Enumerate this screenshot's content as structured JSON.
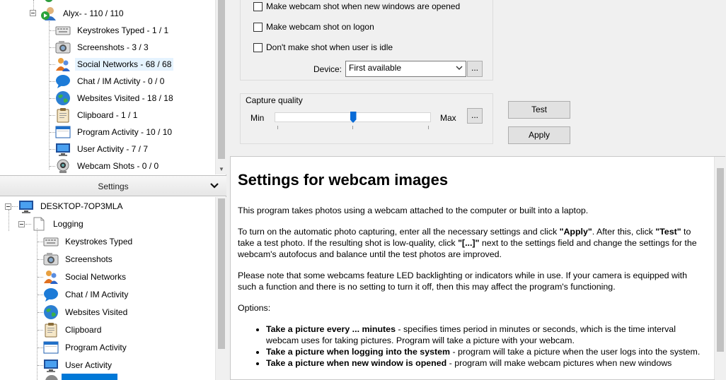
{
  "top_tree": {
    "user_node": "Alyx- - 110 / 110",
    "items": [
      {
        "label": "Keystrokes Typed - 1 / 1",
        "icon": "keyboard-icon"
      },
      {
        "label": "Screenshots - 3 / 3",
        "icon": "camera-icon"
      },
      {
        "label": "Social Networks - 68 / 68",
        "icon": "social-icon",
        "selected": true
      },
      {
        "label": "Chat / IM Activity - 0 / 0",
        "icon": "chat-icon"
      },
      {
        "label": "Websites Visited - 18 / 18",
        "icon": "globe-icon"
      },
      {
        "label": "Clipboard - 1 / 1",
        "icon": "clipboard-icon"
      },
      {
        "label": "Program Activity - 10 / 10",
        "icon": "window-icon"
      },
      {
        "label": "User Activity - 7 / 7",
        "icon": "monitor-icon"
      },
      {
        "label": "Webcam Shots - 0 / 0",
        "icon": "webcam-icon"
      }
    ]
  },
  "settings_bar": {
    "label": "Settings"
  },
  "bottom_tree": {
    "computer": "DESKTOP-7OP3MLA",
    "logging": "Logging",
    "items": [
      {
        "label": "Keystrokes Typed",
        "icon": "keyboard-icon"
      },
      {
        "label": "Screenshots",
        "icon": "camera-icon"
      },
      {
        "label": "Social Networks",
        "icon": "social-icon"
      },
      {
        "label": "Chat / IM Activity",
        "icon": "chat-icon"
      },
      {
        "label": "Websites Visited",
        "icon": "globe-icon"
      },
      {
        "label": "Clipboard",
        "icon": "clipboard-icon"
      },
      {
        "label": "Program Activity",
        "icon": "window-icon"
      },
      {
        "label": "User Activity",
        "icon": "monitor-icon"
      }
    ]
  },
  "webcam_settings": {
    "options": [
      {
        "label": "Make webcam shot when new windows are opened",
        "checked": false
      },
      {
        "label": "Make webcam shot on logon",
        "checked": false
      },
      {
        "label": "Don't make shot when user is idle",
        "checked": false
      }
    ],
    "device_label": "Device:",
    "device_value": "First available",
    "more_button": "...",
    "capture_quality_label": "Capture quality",
    "min_label": "Min",
    "max_label": "Max",
    "quality_value": 0.5,
    "test_button": "Test",
    "apply_button": "Apply"
  },
  "help": {
    "title": "Settings for webcam images",
    "p1": "This program takes photos using a webcam attached to the computer or built into a laptop.",
    "p2a": "To turn on the automatic photo capturing, enter all the necessary settings and click ",
    "p2b": "\"Apply\"",
    "p2c": ". After this, click ",
    "p2d": "\"Test\"",
    "p2e": " to take a test photo. If the resulting shot is low-quality, click ",
    "p2f": "\"[...]\"",
    "p2g": " next to the settings field and change the settings for the webcam's autofocus and balance until the test photos are improved.",
    "p3": "Please note that some webcams feature LED backlighting or indicators while in use. If your camera is equipped with such a function and there is no setting to turn it off, then this may affect the program's functioning.",
    "options_label": "Options:",
    "bullets": [
      {
        "bold": "Take a picture every ... minutes",
        "text": " - specifies times period in minutes or seconds, which is the time interval webcam uses for taking pictures. Program will take a picture with your webcam."
      },
      {
        "bold": "Take a picture when logging into the system",
        "text": " - program will take a picture when the user logs into the system."
      },
      {
        "bold": "Take a picture when new window is opened",
        "text": " - program will make webcam pictures when new windows"
      }
    ]
  }
}
